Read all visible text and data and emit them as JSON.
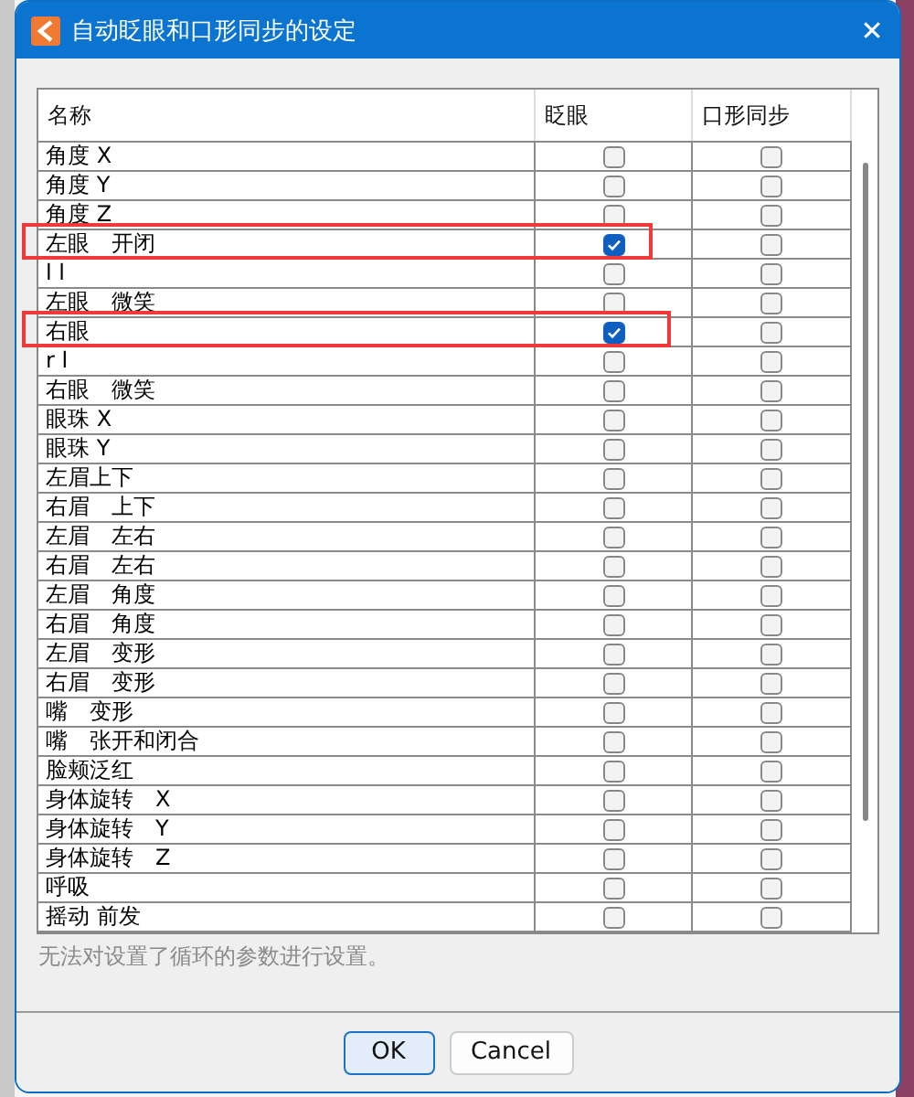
{
  "window": {
    "title": "自动眨眼和口形同步的设定",
    "close": "✕"
  },
  "table": {
    "columns": [
      "名称",
      "眨眼",
      "口形同步"
    ],
    "rows": [
      {
        "name": "角度 X",
        "blink": false,
        "lipsync": false,
        "highlighted": false
      },
      {
        "name": "角度 Y",
        "blink": false,
        "lipsync": false,
        "highlighted": false
      },
      {
        "name": "角度 Z",
        "blink": false,
        "lipsync": false,
        "highlighted": false
      },
      {
        "name": "左眼　开闭",
        "blink": true,
        "lipsync": false,
        "highlighted": true
      },
      {
        "name": "l l",
        "blink": false,
        "lipsync": false,
        "highlighted": false
      },
      {
        "name": "左眼　微笑",
        "blink": false,
        "lipsync": false,
        "highlighted": false
      },
      {
        "name": "右眼",
        "blink": true,
        "lipsync": false,
        "highlighted": true
      },
      {
        "name": "r l",
        "blink": false,
        "lipsync": false,
        "highlighted": false
      },
      {
        "name": "右眼　微笑",
        "blink": false,
        "lipsync": false,
        "highlighted": false
      },
      {
        "name": "眼珠 X",
        "blink": false,
        "lipsync": false,
        "highlighted": false
      },
      {
        "name": "眼珠 Y",
        "blink": false,
        "lipsync": false,
        "highlighted": false
      },
      {
        "name": "左眉上下",
        "blink": false,
        "lipsync": false,
        "highlighted": false
      },
      {
        "name": "右眉　上下",
        "blink": false,
        "lipsync": false,
        "highlighted": false
      },
      {
        "name": "左眉　左右",
        "blink": false,
        "lipsync": false,
        "highlighted": false
      },
      {
        "name": "右眉　左右",
        "blink": false,
        "lipsync": false,
        "highlighted": false
      },
      {
        "name": "左眉　角度",
        "blink": false,
        "lipsync": false,
        "highlighted": false
      },
      {
        "name": "右眉　角度",
        "blink": false,
        "lipsync": false,
        "highlighted": false
      },
      {
        "name": "左眉　变形",
        "blink": false,
        "lipsync": false,
        "highlighted": false
      },
      {
        "name": "右眉　变形",
        "blink": false,
        "lipsync": false,
        "highlighted": false
      },
      {
        "name": "嘴　变形",
        "blink": false,
        "lipsync": false,
        "highlighted": false
      },
      {
        "name": "嘴　张开和闭合",
        "blink": false,
        "lipsync": false,
        "highlighted": false
      },
      {
        "name": "脸颊泛红",
        "blink": false,
        "lipsync": false,
        "highlighted": false
      },
      {
        "name": "身体旋转　X",
        "blink": false,
        "lipsync": false,
        "highlighted": false
      },
      {
        "name": "身体旋转　Y",
        "blink": false,
        "lipsync": false,
        "highlighted": false
      },
      {
        "name": "身体旋转　Z",
        "blink": false,
        "lipsync": false,
        "highlighted": false
      },
      {
        "name": "呼吸",
        "blink": false,
        "lipsync": false,
        "highlighted": false
      },
      {
        "name": "摇动 前发",
        "blink": false,
        "lipsync": false,
        "highlighted": false
      }
    ]
  },
  "note": "无法对设置了循环的参数进行设置。",
  "buttons": [
    {
      "label": "OK",
      "default": true
    },
    {
      "label": "Cancel",
      "default": false
    }
  ]
}
